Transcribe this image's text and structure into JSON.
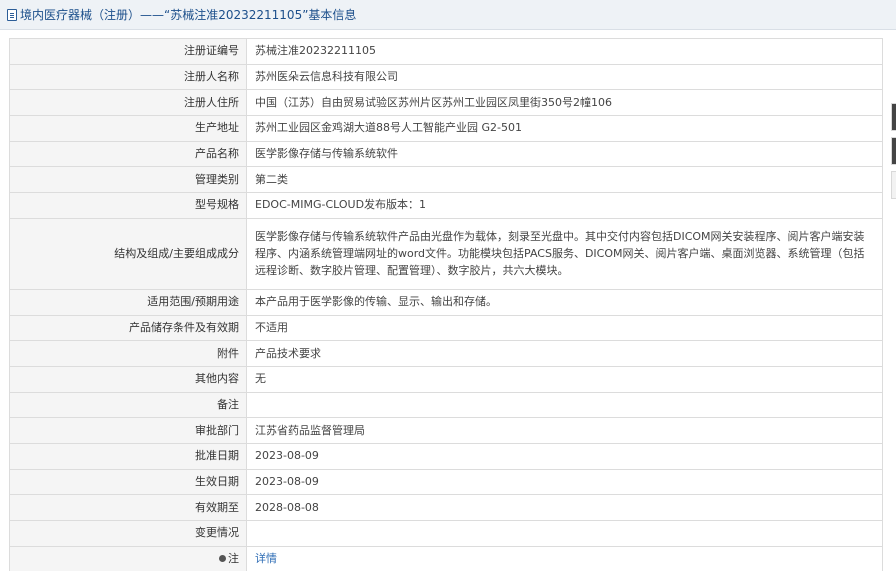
{
  "title": "境内医疗器械（注册）——“苏械注准20232211105”基本信息",
  "rows": [
    {
      "label": "注册证编号",
      "value": "苏械注准20232211105"
    },
    {
      "label": "注册人名称",
      "value": "苏州医朵云信息科技有限公司"
    },
    {
      "label": "注册人住所",
      "value": "中国（江苏）自由贸易试验区苏州片区苏州工业园区凤里街350号2幢106"
    },
    {
      "label": "生产地址",
      "value": "苏州工业园区金鸡湖大道88号人工智能产业园 G2-501"
    },
    {
      "label": "产品名称",
      "value": "医学影像存储与传输系统软件"
    },
    {
      "label": "管理类别",
      "value": "第二类"
    },
    {
      "label": "型号规格",
      "value": "EDOC-MIMG-CLOUD发布版本：1"
    },
    {
      "label": "结构及组成/主要组成成分",
      "value": "医学影像存储与传输系统软件产品由光盘作为载体，刻录至光盘中。其中交付内容包括DICOM网关安装程序、阅片客户端安装程序、内涵系统管理端网址的word文件。功能模块包括PACS服务、DICOM网关、阅片客户端、桌面浏览器、系统管理（包括远程诊断、数字胶片管理、配置管理）、数字胶片，共六大模块。"
    },
    {
      "label": "适用范围/预期用途",
      "value": "本产品用于医学影像的传输、显示、输出和存储。"
    },
    {
      "label": "产品储存条件及有效期",
      "value": "不适用"
    },
    {
      "label": "附件",
      "value": "产品技术要求"
    },
    {
      "label": "其他内容",
      "value": "无"
    },
    {
      "label": "备注",
      "value": ""
    },
    {
      "label": "审批部门",
      "value": "江苏省药品监督管理局"
    },
    {
      "label": "批准日期",
      "value": "2023-08-09"
    },
    {
      "label": "生效日期",
      "value": "2023-08-09"
    },
    {
      "label": "有效期至",
      "value": "2028-08-08"
    },
    {
      "label": "变更情况",
      "value": ""
    }
  ],
  "note": {
    "label": "注",
    "link": "详情",
    "icon": "pin-icon"
  },
  "colors": {
    "title_text": "#1c4f8b",
    "link": "#2d6cb5",
    "label_bg": "#f5f5f5",
    "header_bg": "#eef2f6"
  }
}
